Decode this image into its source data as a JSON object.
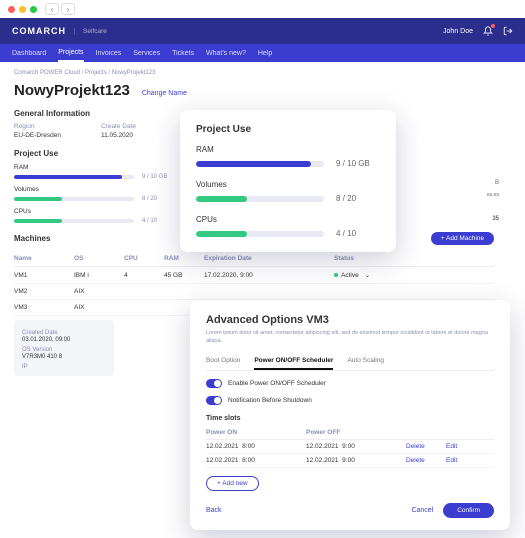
{
  "colors": {
    "brand": "#3b3dd1",
    "brand_dark": "#2c2e8e",
    "green": "#33c980"
  },
  "mac": {
    "back": "‹",
    "fwd": "›"
  },
  "top": {
    "logo": "COMARCH",
    "sub": "Selfcare",
    "user": "John Doe"
  },
  "nav": [
    "Dashboard",
    "Projects",
    "Invoices",
    "Services",
    "Tickets",
    "What's new?",
    "Help"
  ],
  "crumbs": [
    "Comarch POWER Cloud",
    "Projects",
    "NowyProjekt123"
  ],
  "page": {
    "title": "NowyProjekt123",
    "change": "Change Name"
  },
  "general": {
    "heading": "General Information",
    "region_label": "Region",
    "region": "EU-DE-Dresden",
    "created_label": "Create Date",
    "created": "11.05.2020"
  },
  "project_use_bg": {
    "heading": "Project Use",
    "items": [
      {
        "label": "RAM",
        "value": "9 / 10 GB",
        "pct": 90,
        "color": "#3b3dd1"
      },
      {
        "label": "Volumes",
        "value": "8 / 20",
        "pct": 40,
        "color": "#33c980"
      },
      {
        "label": "CPUs",
        "value": "4 / 10",
        "pct": 40,
        "color": "#33c980"
      }
    ]
  },
  "machines": {
    "heading": "Machines",
    "add_btn": "+ Add Machine",
    "cols": [
      "Name",
      "OS",
      "CPU",
      "RAM",
      "Expiration Date",
      "",
      "Status"
    ],
    "rows": [
      {
        "name": "VM1",
        "os": "IBM i",
        "cpu": "4",
        "ram": "45 GB",
        "exp": "17.02.2020, 9:00",
        "status": "Active"
      },
      {
        "name": "VM2",
        "os": "AIX",
        "cpu": "",
        "ram": "",
        "exp": "",
        "status": ""
      },
      {
        "name": "VM3",
        "os": "AIX",
        "cpu": "",
        "ram": "",
        "exp": "",
        "status": ""
      }
    ],
    "detail": {
      "created_h": "Created Date",
      "created": "03.01.2020, 09:00",
      "osver_h": "OS Version",
      "osver": "V7R3M0 410 8",
      "ip_h": "IP"
    }
  },
  "right_frag": {
    "line1": "B",
    "line2": "es.es",
    "line3": "35"
  },
  "pu_card": {
    "title": "Project Use",
    "rows": [
      {
        "label": "RAM",
        "value": "9 / 10 GB",
        "pct": 90,
        "color": "#3b3dd1"
      },
      {
        "label": "Volumes",
        "value": "8 / 20",
        "pct": 40,
        "color": "#33c980"
      },
      {
        "label": "CPUs",
        "value": "4 / 10",
        "pct": 40,
        "color": "#33c980"
      }
    ]
  },
  "adv": {
    "title": "Advanced Options VM3",
    "lorem": "Lorem ipsum dolor sit amet, consectetur adipiscing elit, sed do eiusmod tempor incididunt ut labore et dolore magna aliqua.",
    "tabs": [
      "Boot Option",
      "Power ON/OFF Scheduler",
      "Auto Scaling"
    ],
    "active_tab": 1,
    "toggle1": "Enable Power ON/OFF Scheduler",
    "toggle2": "Notification Before Shutdown",
    "ts_heading": "Time slots",
    "ts_cols": [
      "Power ON",
      "Power OFF",
      "",
      ""
    ],
    "ts_rows": [
      {
        "on_date": "12.02.2021",
        "on_time": "8:00",
        "off_date": "12.02.2021",
        "off_time": "9:00",
        "del": "Delete",
        "edit": "Edit"
      },
      {
        "on_date": "12.02.2021",
        "on_time": "8:00",
        "off_date": "12.02.2021",
        "off_time": "9:00",
        "del": "Delete",
        "edit": "Edit"
      }
    ],
    "add_new": "+ Add new",
    "back": "Back",
    "cancel": "Cancel",
    "confirm": "Confirm"
  }
}
